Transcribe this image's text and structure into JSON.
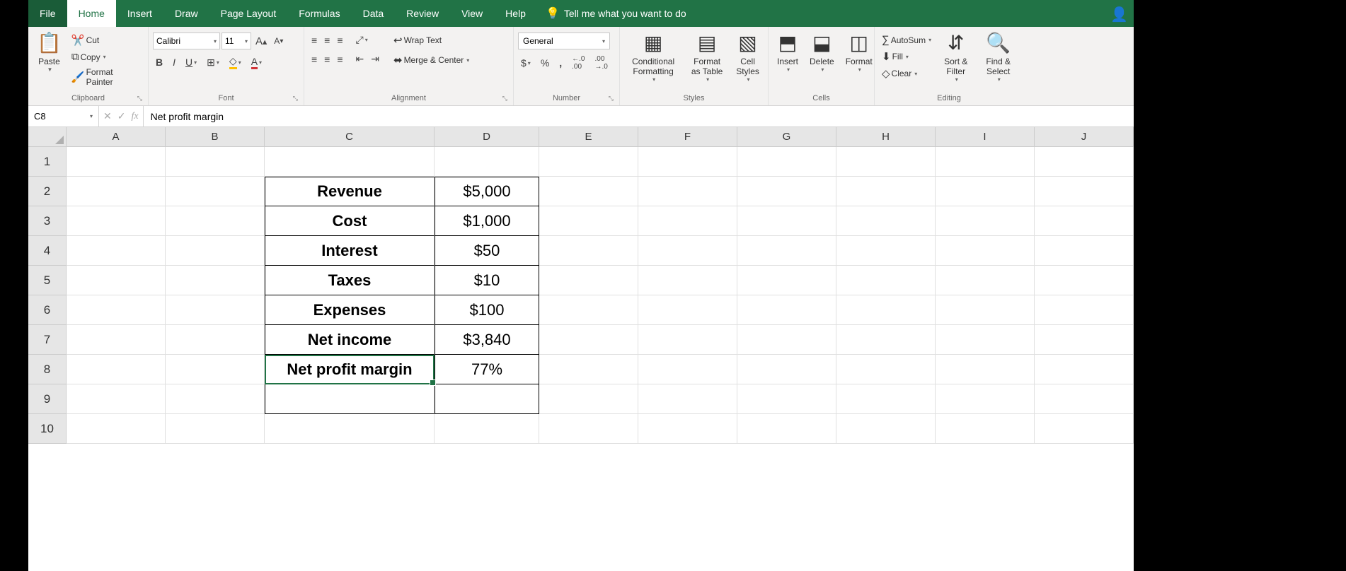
{
  "menu": {
    "file": "File",
    "home": "Home",
    "insert": "Insert",
    "draw": "Draw",
    "page_layout": "Page Layout",
    "formulas": "Formulas",
    "data": "Data",
    "review": "Review",
    "view": "View",
    "help": "Help",
    "tell_me": "Tell me what you want to do"
  },
  "ribbon": {
    "paste": "Paste",
    "cut": "Cut",
    "copy": "Copy",
    "format_painter": "Format Painter",
    "clipboard": "Clipboard",
    "font_name": "Calibri",
    "font_size": "11",
    "font": "Font",
    "wrap_text": "Wrap Text",
    "merge_center": "Merge & Center",
    "alignment": "Alignment",
    "number_format": "General",
    "number": "Number",
    "cond_fmt": "Conditional Formatting",
    "fmt_table": "Format as Table",
    "cell_styles": "Cell Styles",
    "styles": "Styles",
    "insert_c": "Insert",
    "delete_c": "Delete",
    "format_c": "Format",
    "cells": "Cells",
    "autosum": "AutoSum",
    "fill": "Fill",
    "clear": "Clear",
    "sort_filter": "Sort & Filter",
    "find_select": "Find & Select",
    "editing": "Editing"
  },
  "formula_bar": {
    "name_box": "C8",
    "formula": "Net profit margin"
  },
  "columns": [
    "A",
    "B",
    "C",
    "D",
    "E",
    "F",
    "G",
    "H",
    "I",
    "J"
  ],
  "rows": [
    "1",
    "2",
    "3",
    "4",
    "5",
    "6",
    "7",
    "8",
    "9",
    "10"
  ],
  "table": {
    "r2c": "Revenue",
    "r2d": "$5,000",
    "r3c": "Cost",
    "r3d": "$1,000",
    "r4c": "Interest",
    "r4d": "$50",
    "r5c": "Taxes",
    "r5d": "$10",
    "r6c": "Expenses",
    "r6d": "$100",
    "r7c": "Net income",
    "r7d": "$3,840",
    "r8c": "Net profit margin",
    "r8d": "77%"
  }
}
